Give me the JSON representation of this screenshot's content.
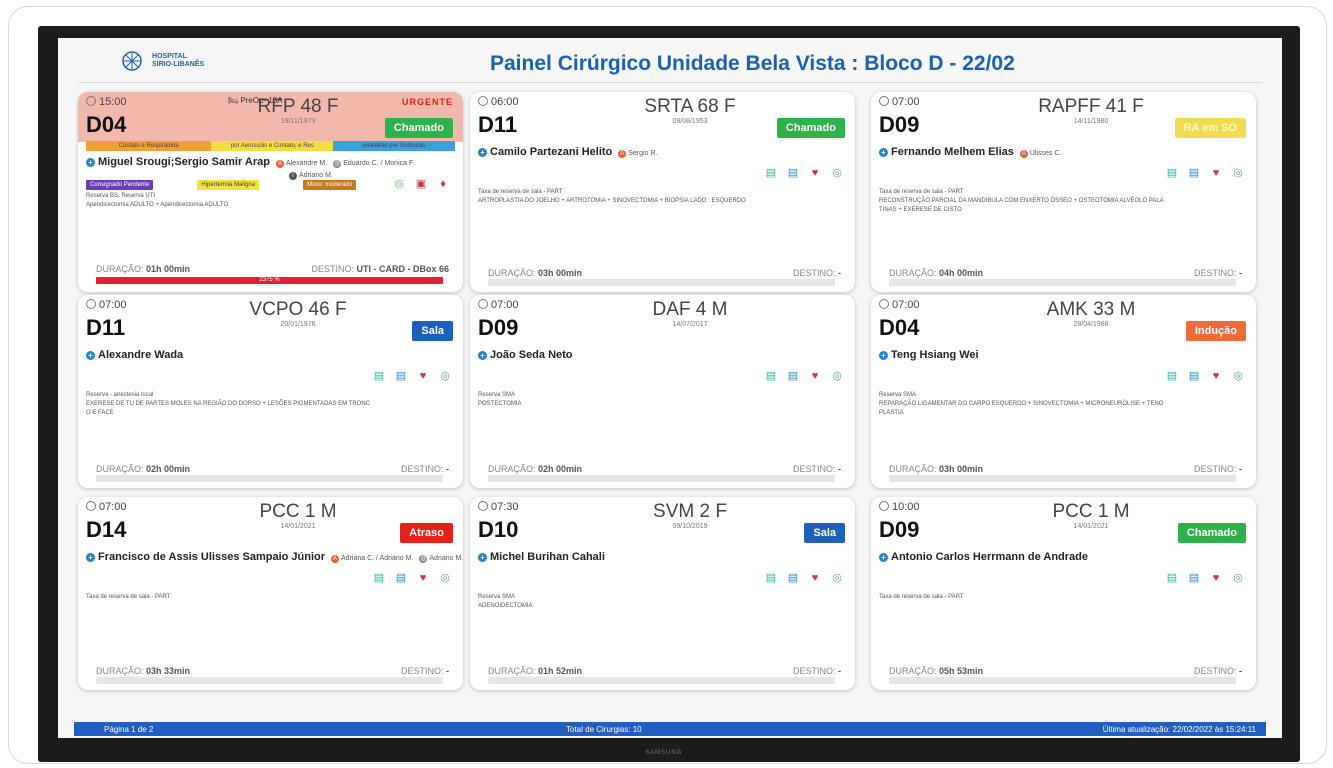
{
  "header": {
    "logo_line1": "HOSPITAL",
    "logo_line2": "SÍRIO-LIBANÊS",
    "title": "Painel Cirúrgico Unidade Bela Vista : Bloco D - 22/02"
  },
  "colors": {
    "accent": "#1d5fb0",
    "chamado": "#2fb24a",
    "sala": "#1f5fbd",
    "atraso": "#e2231a",
    "inducao": "#ef6a3a",
    "ra_em_so": "#f2dc55",
    "urgent_bg": "#f3b8ac"
  },
  "cards": [
    {
      "time": "15:00",
      "room": "D04",
      "code": "RFP 48 F",
      "dob": "19/11/1973",
      "status": "Chamado",
      "preop": "PreOp- 15A",
      "urgent": "URGENTE",
      "stripe": [
        "Contato e Respiratória",
        "por Aerossóis e Contato, e Res",
        "piratórias por Gotículas"
      ],
      "doctor": "Miguel Srougi;Sergio Samir Arap",
      "anes1": "Alexandre M.",
      "anes2": "Eduardo C. / Monica F.",
      "anes3": "Adriano M.",
      "tags": [
        "Consignado Pendente",
        "Hipertermia Maligna",
        "Muvo: moderado"
      ],
      "info": [
        "Reserva BS, Reserva UTI",
        "Apendicectomia ADULTO + Apendicectomia ADULTO"
      ],
      "duration_label": "DURAÇÃO:",
      "duration": "01h 00min",
      "dest_label": "DESTINO:",
      "dest": "UTI - CARD - DBox 66",
      "progress": "2375 %"
    },
    {
      "time": "06:00",
      "room": "D11",
      "code": "SRTA 68 F",
      "dob": "09/08/1953",
      "status": "Chamado",
      "doctor": "Camilo Partezani Helito",
      "anes1": "Sergio R.",
      "info": [
        "Taxa de reserva de sala - PART",
        "ARTROPLASTIA DO JOELHO + ARTROTOMIA + SINOVECTOMIA + BIOPSIA LADO : ESQUERDO"
      ],
      "duration_label": "DURAÇÃO:",
      "duration": "03h 00min",
      "dest_label": "DESTINO:",
      "dest": "-"
    },
    {
      "time": "07:00",
      "room": "D09",
      "code": "RAPFF 41 F",
      "dob": "14/11/1980",
      "status": "RA em SO",
      "doctor": "Fernando Melhem Elias",
      "anes1": "Ulisses C.",
      "info": [
        "Taxa de reserva de sala - PART",
        "RECONSTRUÇÃO PARCIAL DA MANDIBULA COM ENXERTO ÓSSEO + OSTEOTOMIA ALVÉOLO PALA",
        "TINAS + EXÉRESE DE CISTO"
      ],
      "duration_label": "DURAÇÃO:",
      "duration": "04h 00min",
      "dest_label": "DESTINO:",
      "dest": "-"
    },
    {
      "time": "07:00",
      "room": "D11",
      "code": "VCPO 46 F",
      "dob": "20/01/1976",
      "status": "Sala",
      "doctor": "Alexandre Wada",
      "info": [
        "Reserva - anestesia local",
        "EXERESE DE TU DE PARTES MOLES NA REGIÃO DO DORSO + LESÕES PIGMENTADAS EM TRONC",
        "O E FACE"
      ],
      "duration_label": "DURAÇÃO:",
      "duration": "02h 00min",
      "dest_label": "DESTINO:",
      "dest": "-"
    },
    {
      "time": "07:00",
      "room": "D09",
      "code": "DAF 4 M",
      "dob": "14/07/2017",
      "status": "",
      "doctor": "João Seda Neto",
      "info": [
        "Reserva SMA",
        "POSTECTOMIA"
      ],
      "duration_label": "DURAÇÃO:",
      "duration": "02h 00min",
      "dest_label": "DESTINO:",
      "dest": "-"
    },
    {
      "time": "07:00",
      "room": "D04",
      "code": "AMK 33 M",
      "dob": "28/04/1988",
      "status": "Indução",
      "doctor": "Teng Hsiang Wei",
      "info": [
        "Reserva SMA",
        "REPARAÇÃO LIGAMENTAR DO CARPO ESQUERDO + SINOVECTOMIA + MICRONEURÓLISE + TENO",
        "PLASTIA"
      ],
      "duration_label": "DURAÇÃO:",
      "duration": "03h 00min",
      "dest_label": "DESTINO:",
      "dest": "-"
    },
    {
      "time": "07:00",
      "room": "D14",
      "code": "PCC 1 M",
      "dob": "14/01/2021",
      "status": "Atraso",
      "doctor": "Francisco de Assis Ulisses Sampaio Júnior",
      "anes1": "Adriana C. / Adriano M.",
      "anes2": "Adriano M.",
      "info": [
        "Taxa de reserva de sala - PART"
      ],
      "duration_label": "DURAÇÃO:",
      "duration": "03h 33min",
      "dest_label": "DESTINO:",
      "dest": "-"
    },
    {
      "time": "07:30",
      "room": "D10",
      "code": "SVM 2 F",
      "dob": "09/10/2019",
      "status": "Sala",
      "doctor": "Michel Burihan Cahali",
      "info": [
        "Reserva SMA",
        "ADENOIDECTOMIA"
      ],
      "duration_label": "DURAÇÃO:",
      "duration": "01h 52min",
      "dest_label": "DESTINO:",
      "dest": "-"
    },
    {
      "time": "10:00",
      "room": "D09",
      "code": "PCC 1 M",
      "dob": "14/01/2021",
      "status": "Chamado",
      "doctor": "Antonio Carlos Herrmann de Andrade",
      "info": [
        "Taxa de reserva de sala - PART"
      ],
      "duration_label": "DURAÇÃO:",
      "duration": "05h 53min",
      "dest_label": "DESTINO:",
      "dest": "-"
    }
  ],
  "footer": {
    "page": "Página 1 de 2",
    "total": "Total de Cirurgias: 10",
    "updated": "Última atualização: 22/02/2022 às 15:24:11"
  },
  "bezel_brand": "SAMSUNG"
}
